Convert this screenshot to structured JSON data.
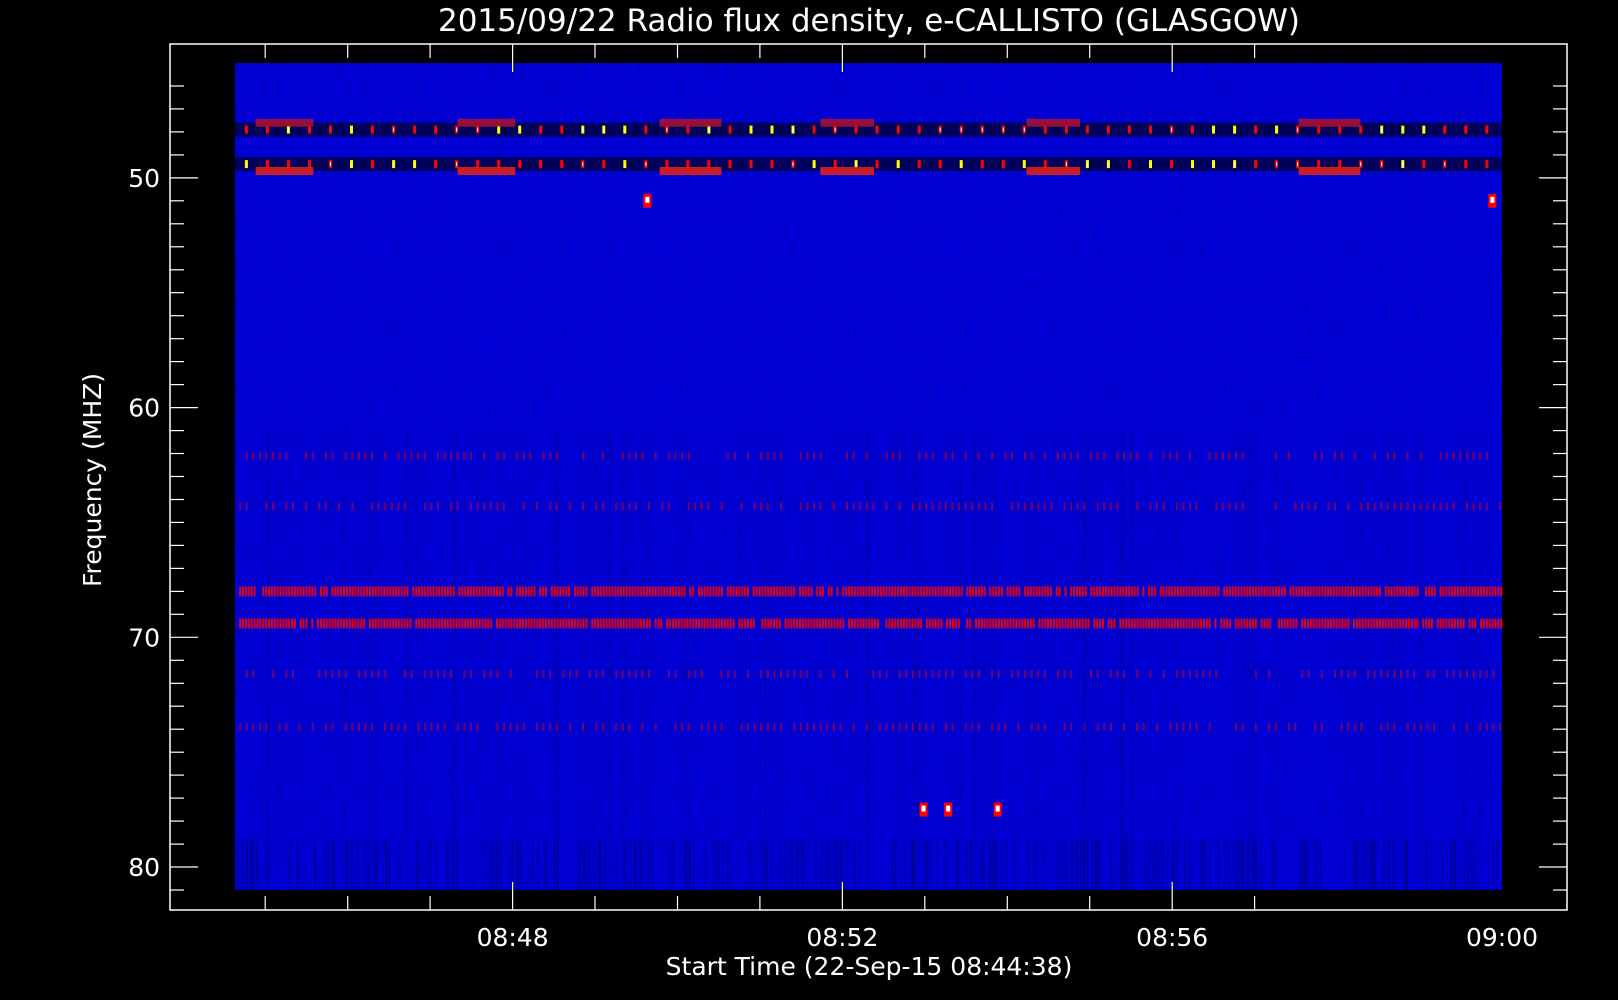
{
  "chart_data": {
    "type": "heatmap",
    "title": "2015/09/22  Radio flux density, e-CALLISTO (GLASGOW)",
    "xlabel": "Start Time (22-Sep-15 08:44:38)",
    "ylabel": "Frequency (MHZ)",
    "x_range_minutes": [
      0,
      15.3667
    ],
    "x_axis_origin": "08:44:38",
    "y_range_mhz": [
      45,
      81
    ],
    "y_inverted": true,
    "x_ticks": [
      "08:48",
      "08:52",
      "08:56",
      "09:00"
    ],
    "x_tick_minutes": [
      3.3667,
      7.3667,
      11.3667,
      15.3667
    ],
    "y_ticks": [
      50,
      60,
      70,
      80
    ],
    "y_tick_labels": [
      "50",
      "60",
      "70",
      "80"
    ],
    "colormap": [
      "#0000ff",
      "#1a1aaa",
      "#ff0000",
      "#ffff00",
      "#ffffff"
    ],
    "background_intensity": "low (blue)",
    "emission_bands": [
      {
        "freq_mhz": 47.9,
        "character": "periodic bursts",
        "intensity": "high"
      },
      {
        "freq_mhz": 49.4,
        "character": "periodic bursts",
        "intensity": "high"
      },
      {
        "freq_mhz": 62.1,
        "character": "intermittent",
        "intensity": "moderate"
      },
      {
        "freq_mhz": 64.3,
        "character": "intermittent",
        "intensity": "moderate"
      },
      {
        "freq_mhz": 68.0,
        "character": "continuous interference",
        "intensity": "high"
      },
      {
        "freq_mhz": 69.4,
        "character": "continuous interference",
        "intensity": "high"
      },
      {
        "freq_mhz": 71.6,
        "character": "intermittent",
        "intensity": "moderate"
      },
      {
        "freq_mhz": 73.9,
        "character": "intermittent",
        "intensity": "moderate"
      }
    ],
    "burst_group_minutes": [
      [
        0.25,
        0.95
      ],
      [
        2.7,
        3.4
      ],
      [
        5.15,
        5.9
      ],
      [
        7.1,
        7.75
      ],
      [
        9.6,
        10.25
      ],
      [
        12.9,
        13.65
      ]
    ],
    "isolated_points": [
      {
        "minute": 5.0,
        "freq_mhz": 51.0
      },
      {
        "minute": 15.25,
        "freq_mhz": 51.0
      },
      {
        "minute": 8.35,
        "freq_mhz": 77.5
      },
      {
        "minute": 8.65,
        "freq_mhz": 77.5
      },
      {
        "minute": 9.25,
        "freq_mhz": 77.5
      }
    ],
    "grid": false,
    "legend": "none"
  }
}
